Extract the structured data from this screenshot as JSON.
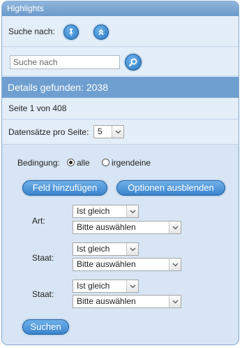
{
  "panel": {
    "title": "Highlights"
  },
  "search_header": {
    "label": "Suche nach:",
    "pin_icon": "pin-icon",
    "collapse_icon": "chevron-up-double-icon"
  },
  "search": {
    "placeholder": "Suche nach",
    "value": "",
    "button_icon": "search-icon"
  },
  "results": {
    "found_text": "Details gefunden: 2038",
    "page_text": "Seite 1 von 408"
  },
  "per_page": {
    "label": "Datensätze pro Seite:",
    "value": "5"
  },
  "filter": {
    "condition_label": "Bedingung:",
    "options": [
      {
        "label": "alle",
        "checked": true
      },
      {
        "label": "irgendeine",
        "checked": false
      }
    ],
    "add_field_label": "Feld hinzufügen",
    "hide_options_label": "Optionen ausblenden",
    "rows": [
      {
        "label": "Art:",
        "operator": "Ist gleich",
        "value": "Bitte auswählen"
      },
      {
        "label": "Staat:",
        "operator": "Ist gleich",
        "value": "Bitte auswählen"
      },
      {
        "label": "Staat:",
        "operator": "Ist gleich",
        "value": "Bitte auswählen"
      }
    ],
    "submit_label": "Suchen"
  },
  "colors": {
    "accent": "#3a84cc",
    "header_band": "#6f9fd0",
    "panel_bg": "#dce8f5"
  }
}
